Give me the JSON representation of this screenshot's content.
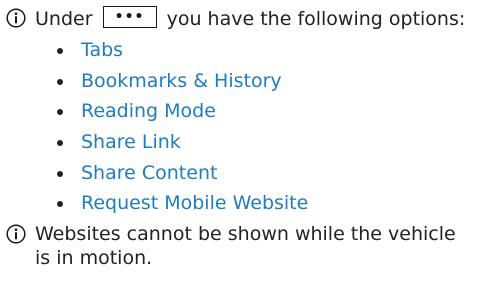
{
  "note1": {
    "icon": "info-icon",
    "text_before": "Under",
    "menu_glyph": "•••",
    "text_after": "you have the following options:"
  },
  "options": [
    {
      "label": "Tabs"
    },
    {
      "label": "Bookmarks & History"
    },
    {
      "label": "Reading Mode"
    },
    {
      "label": "Share Link"
    },
    {
      "label": "Share Content"
    },
    {
      "label": "Request Mobile Website"
    }
  ],
  "note2": {
    "icon": "info-icon",
    "text": "Websites cannot be shown while the vehicle is in motion."
  },
  "colors": {
    "link": "#1e7dbf",
    "text": "#222222",
    "icon": "#1a1a1a"
  }
}
